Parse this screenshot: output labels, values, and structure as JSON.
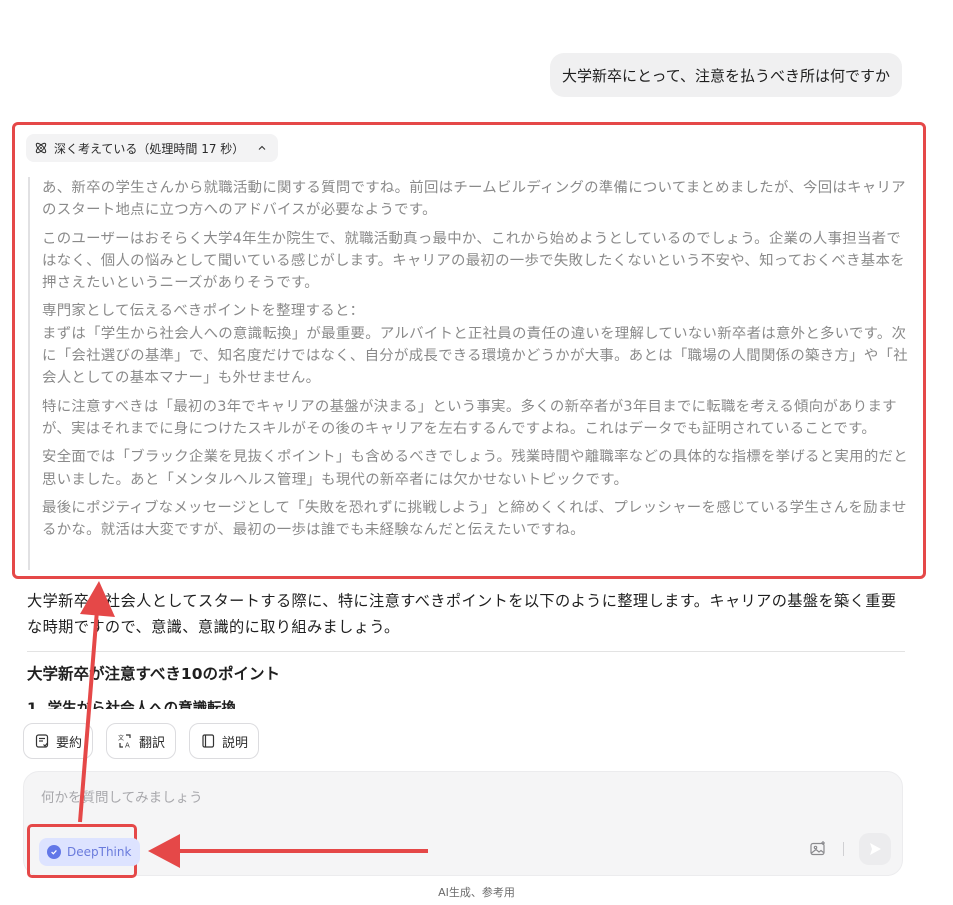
{
  "user_message": "大学新卒にとって、注意を払うべき所は何ですか",
  "thinking": {
    "toggle_label": "深く考えている（処理時間 17 秒）",
    "paragraphs": [
      "あ、新卒の学生さんから就職活動に関する質問ですね。前回はチームビルディングの準備についてまとめましたが、今回はキャリアのスタート地点に立つ方へのアドバイスが必要なようです。",
      "このユーザーはおそらく大学4年生か院生で、就職活動真っ最中か、これから始めようとしているのでしょう。企業の人事担当者ではなく、個人の悩みとして聞いている感じがします。キャリアの最初の一歩で失敗したくないという不安や、知っておくべき基本を押さえたいというニーズがありそうです。",
      "専門家として伝えるべきポイントを整理すると：\nまずは「学生から社会人への意識転換」が最重要。アルバイトと正社員の責任の違いを理解していない新卒者は意外と多いです。次に「会社選びの基準」で、知名度だけではなく、自分が成長できる環境かどうかが大事。あとは「職場の人間関係の築き方」や「社会人としての基本マナー」も外せません。",
      "特に注意すべきは「最初の3年でキャリアの基盤が決まる」という事実。多くの新卒者が3年目までに転職を考える傾向がありますが、実はそれまでに身につけたスキルがその後のキャリアを左右するんですよね。これはデータでも証明されていることです。",
      "安全面では「ブラック企業を見抜くポイント」も含めるべきでしょう。残業時間や離職率などの具体的な指標を挙げると実用的だと思いました。あと「メンタルヘルス管理」も現代の新卒者には欠かせないトピックです。",
      "最後にポジティブなメッセージとして「失敗を恐れずに挑戦しよう」と締めくくれば、プレッシャーを感じている学生さんを励ませるかな。就活は大変ですが、最初の一歩は誰でも未経験なんだと伝えたいですね。"
    ]
  },
  "answer": {
    "intro": "大学新卒が社会人としてスタートする際に、特に注意すべきポイントを以下のように整理します。キャリアの基盤を築く重要な時期ですので、意識、意識的に取り組みましょう。",
    "heading": "大学新卒が注意すべき10のポイント",
    "subheading": "1. 学生から社会人への意識転換"
  },
  "actions": [
    {
      "label": "要約",
      "icon": "summary-icon"
    },
    {
      "label": "翻訳",
      "icon": "translate-icon"
    },
    {
      "label": "説明",
      "icon": "book-icon"
    }
  ],
  "input": {
    "placeholder": "何かを質問してみましょう",
    "value": "",
    "deepthink_label": "DeepThink"
  },
  "footer": "AI生成、参考用",
  "colors": {
    "annotation_red": "#e54848",
    "deepthink_bg": "#dde3ff",
    "deepthink_text": "#6a7bdc"
  }
}
